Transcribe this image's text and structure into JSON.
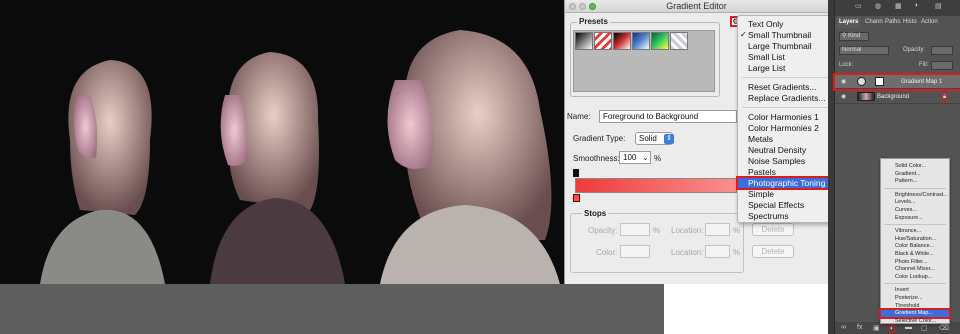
{
  "dialog": {
    "title": "Gradient Editor",
    "presets_label": "Presets",
    "name_label": "Name:",
    "name_value": "Foreground to Background",
    "gradient_type_label": "Gradient Type:",
    "gradient_type_value": "Solid",
    "smoothness_label": "Smoothness:",
    "smoothness_value": "100",
    "smoothness_unit": "%",
    "stops_label": "Stops",
    "opacity_label": "Opacity:",
    "opacity_unit": "%",
    "location_label": "Location:",
    "location_unit": "%",
    "color_label": "Color:",
    "delete_label": "Delete",
    "gear_icon": "gear-icon"
  },
  "presets_menu": {
    "items_group1": [
      {
        "label": "Text Only",
        "checked": false
      },
      {
        "label": "Small Thumbnail",
        "checked": true
      },
      {
        "label": "Large Thumbnail",
        "checked": false
      },
      {
        "label": "Small List",
        "checked": false
      },
      {
        "label": "Large List",
        "checked": false
      }
    ],
    "items_group2": [
      "Reset Gradients...",
      "Replace Gradients..."
    ],
    "items_group3": [
      "Color Harmonies 1",
      "Color Harmonies 2",
      "Metals",
      "Neutral Density",
      "Noise Samples",
      "Pastels",
      "Photographic Toning",
      "Simple",
      "Special Effects",
      "Spectrums"
    ],
    "selected": "Photographic Toning"
  },
  "layers_panel": {
    "tabs": [
      "Layers",
      "Chann",
      "Paths",
      "Histo",
      "Action"
    ],
    "kind_label": "Kind",
    "blend_mode": "Normal",
    "opacity_label": "Opacity:",
    "lock_label": "Lock:",
    "fill_label": "Fill:",
    "layers": [
      "Gradient Map 1",
      "Background"
    ]
  },
  "adjustment_menu": {
    "group1": [
      "Solid Color...",
      "Gradient...",
      "Pattern..."
    ],
    "group2": [
      "Brightness/Contrast...",
      "Levels...",
      "Curves...",
      "Exposure..."
    ],
    "group3": [
      "Vibrance...",
      "Hue/Saturation...",
      "Color Balance...",
      "Black & White...",
      "Photo Filter...",
      "Channel Mixer...",
      "Color Lookup..."
    ],
    "group4": [
      "Invert",
      "Posterize...",
      "Threshold",
      "Gradient Map...",
      "Selective Color..."
    ],
    "selected": "Gradient Map..."
  },
  "colors": {
    "highlight_red": "#d91c1c",
    "menu_selection_blue": "#3d6ddb",
    "gradient_start": "#ee3b3b",
    "gradient_end": "#fb8f8f"
  }
}
